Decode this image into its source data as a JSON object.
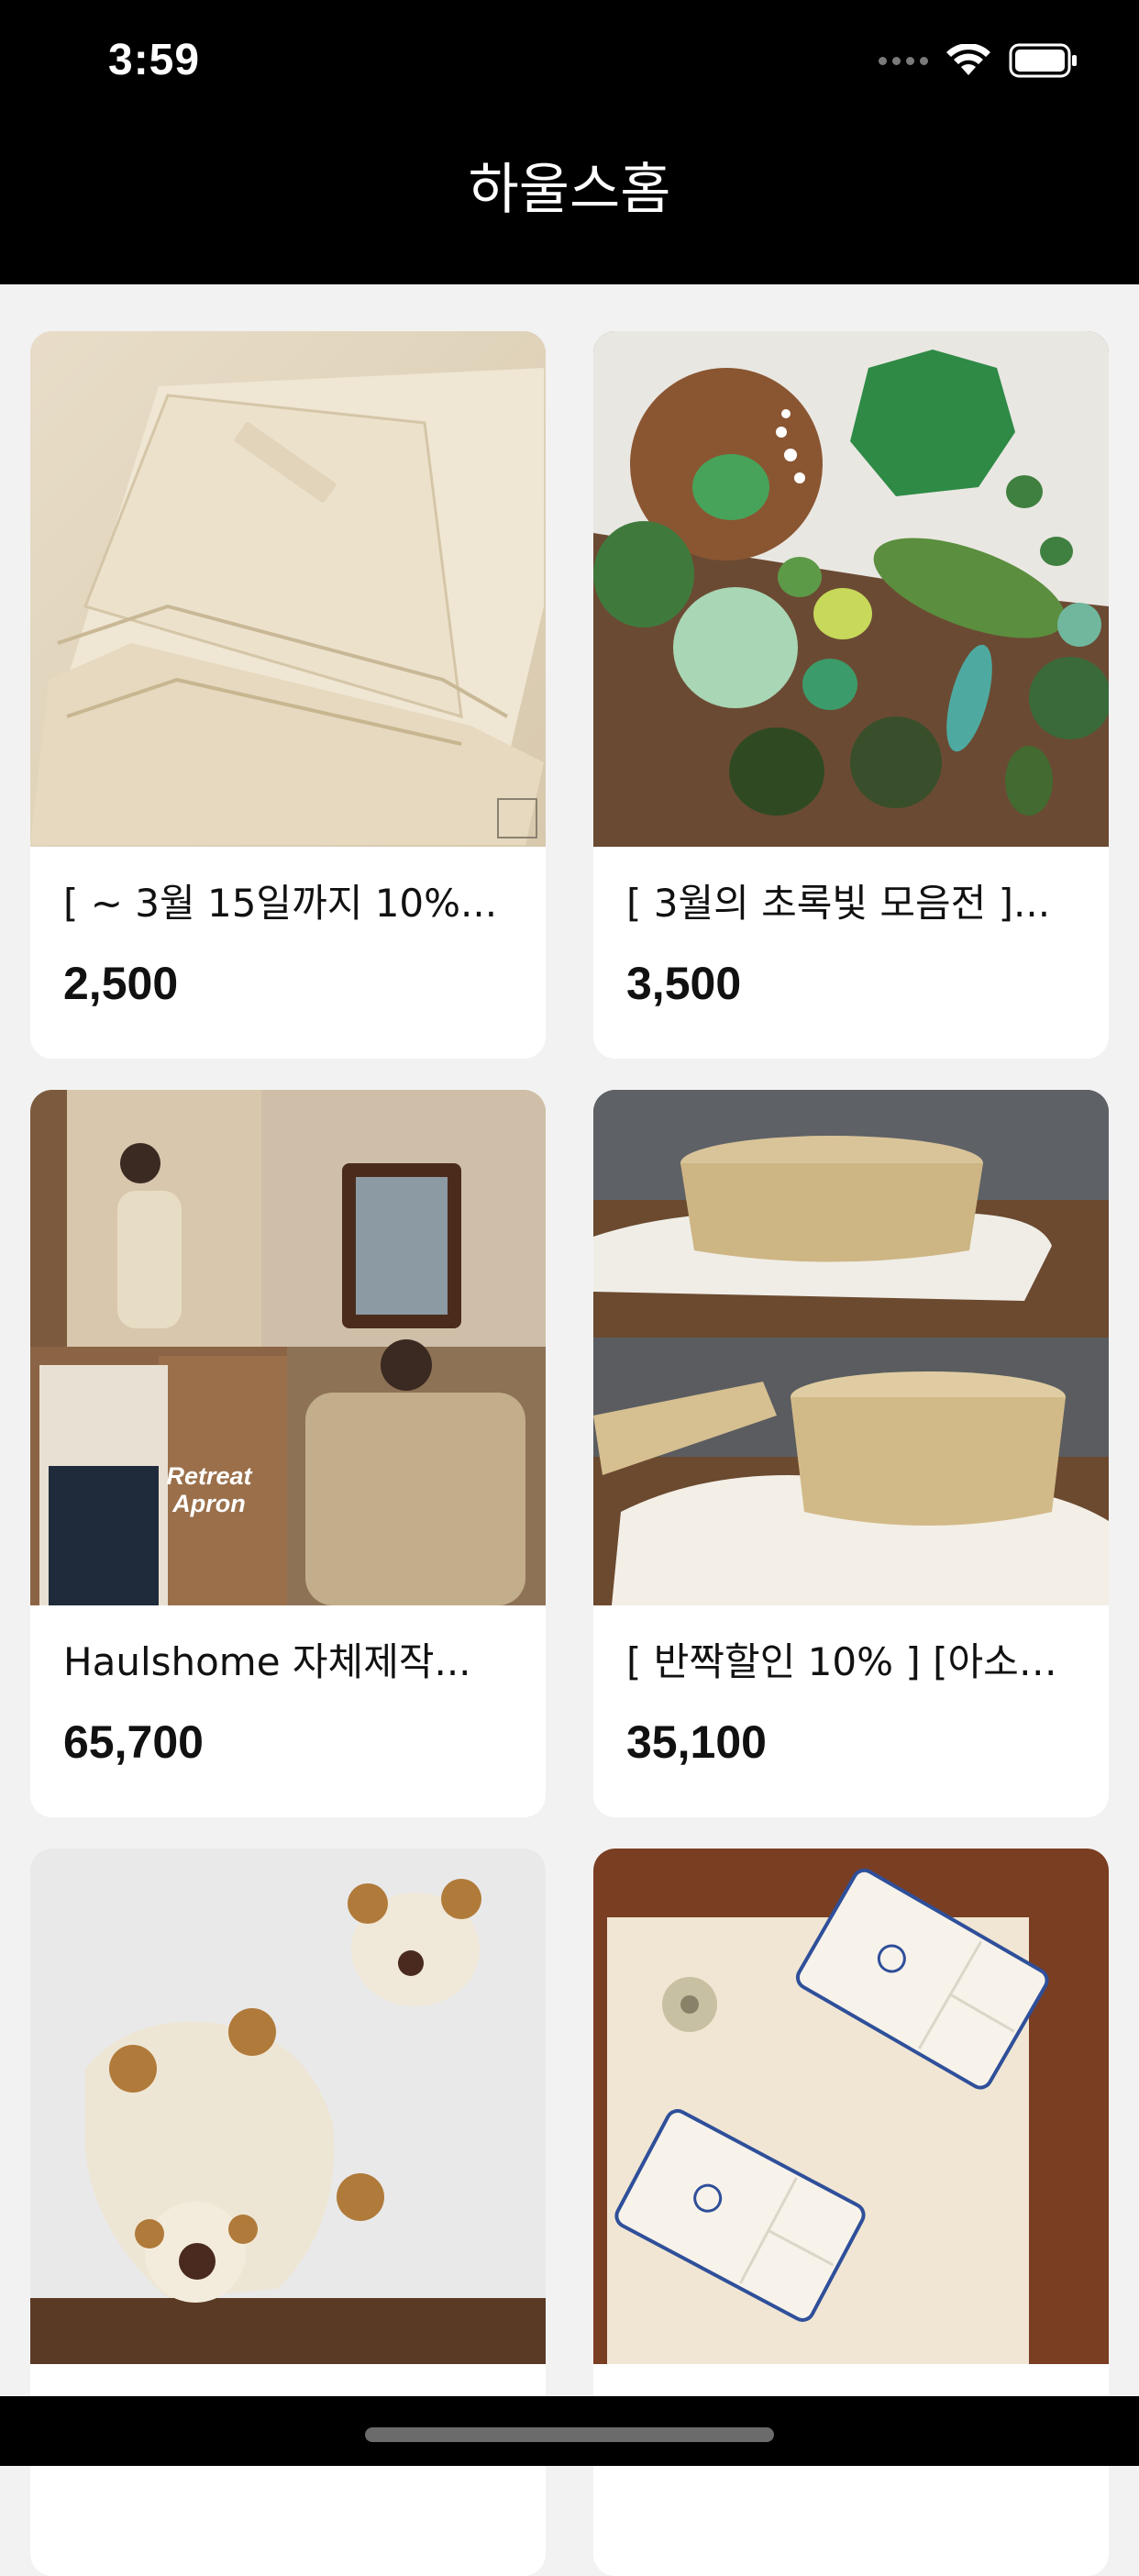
{
  "status_bar": {
    "time": "3:59"
  },
  "nav": {
    "title": "하울스홈"
  },
  "products": [
    {
      "title": "[ ~ 3월 15일까지 10%...",
      "price": "2,500",
      "image": "folded-linen-cloth"
    },
    {
      "title": "[ 3월의 초록빛 모음전 ]...",
      "price": "3,500",
      "image": "green-ceramic-dishes"
    },
    {
      "title": "Haulshome 자체제작...",
      "price": "65,700",
      "image": "retreat-apron-collage",
      "image_text": "Retreat\nApron"
    },
    {
      "title": "[ 반짝할인 10% ] [아소…",
      "price": "35,100",
      "image": "bamboo-baskets"
    },
    {
      "title": "",
      "price": "",
      "image": "felt-bear-coasters"
    },
    {
      "title": "",
      "price": "",
      "image": "blue-white-divided-plates"
    }
  ],
  "icons": {
    "wifi": "wifi-icon",
    "battery": "battery-icon",
    "signal": "cellular-signal-icon"
  }
}
